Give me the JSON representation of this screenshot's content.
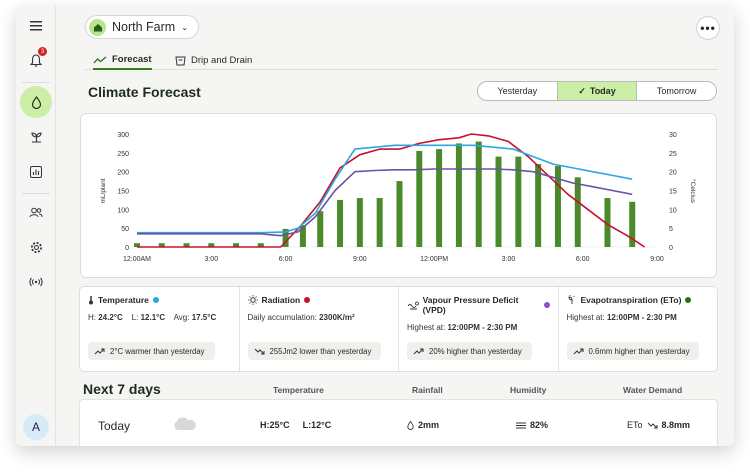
{
  "sidebar": {
    "notification_count": "3",
    "avatar_initial": "A"
  },
  "header": {
    "farm_name": "North Farm"
  },
  "tabs": [
    {
      "label": "Forecast"
    },
    {
      "label": "Drip and Drain"
    }
  ],
  "page_title": "Climate Forecast",
  "day_selector": {
    "options": [
      "Yesterday",
      "Today",
      "Tomorrow"
    ],
    "selected": "Today"
  },
  "chart_data": {
    "type": "bar+line",
    "x_ticks": [
      "12:00AM",
      "3:00",
      "6:00",
      "9:00",
      "12:00PM",
      "3:00",
      "6:00",
      "9:00"
    ],
    "y_left": {
      "label": "mL/plant",
      "ticks": [
        "0",
        "50",
        "100",
        "150",
        "200",
        "250",
        "300"
      ],
      "range": [
        0,
        300
      ]
    },
    "y_right": {
      "label": "°Celcius",
      "ticks": [
        "0",
        "5",
        "10",
        "15",
        "20",
        "25",
        "30"
      ],
      "range": [
        0,
        30
      ]
    },
    "bars": {
      "color": "#4a8a2a",
      "hours": [
        0,
        1,
        2,
        3,
        4,
        5,
        6,
        7,
        8,
        9,
        10,
        11,
        12,
        13,
        14,
        15,
        16,
        17,
        18,
        19,
        20,
        21
      ],
      "values": [
        10,
        10,
        10,
        10,
        10,
        10,
        48,
        58,
        95,
        125,
        130,
        130,
        175,
        255,
        260,
        275,
        280,
        240,
        240,
        220,
        215,
        185,
        130,
        120
      ]
    },
    "bar_hours": [
      0,
      1,
      2,
      3,
      4,
      5,
      6,
      6.7,
      7.4,
      8.2,
      9,
      9.8,
      10.6,
      11.4,
      12.2,
      13,
      13.8,
      14.6,
      15.4,
      16.2,
      17,
      17.8,
      19,
      20
    ],
    "series": [
      {
        "color": "#c8102e",
        "points": [
          [
            0,
            0
          ],
          [
            5.8,
            0
          ],
          [
            6.6,
            5.5
          ],
          [
            7.4,
            12
          ],
          [
            8.2,
            21
          ],
          [
            9,
            24.5
          ],
          [
            9.8,
            26
          ],
          [
            10.6,
            26
          ],
          [
            11.4,
            27.5
          ],
          [
            12.2,
            28.5
          ],
          [
            13,
            29
          ],
          [
            13.5,
            30
          ],
          [
            14.2,
            29.5
          ],
          [
            15,
            28
          ],
          [
            15.8,
            24
          ],
          [
            16.6,
            19
          ],
          [
            17.4,
            14
          ],
          [
            18.2,
            10
          ],
          [
            19,
            6
          ],
          [
            19.8,
            3
          ],
          [
            20.5,
            0
          ]
        ]
      },
      {
        "color": "#2aa7e0",
        "points": [
          [
            0,
            3.8
          ],
          [
            5,
            3.8
          ],
          [
            6,
            4
          ],
          [
            6.5,
            5
          ],
          [
            7.2,
            9
          ],
          [
            8,
            18
          ],
          [
            8.8,
            26
          ],
          [
            9.6,
            26.5
          ],
          [
            10.4,
            27
          ],
          [
            11.2,
            27
          ],
          [
            12,
            27
          ],
          [
            12.8,
            27
          ],
          [
            13.6,
            27
          ],
          [
            14.4,
            26.5
          ],
          [
            15.2,
            26
          ],
          [
            16,
            24
          ],
          [
            16.8,
            22
          ],
          [
            17.6,
            21
          ],
          [
            18.4,
            20
          ],
          [
            19.2,
            19
          ],
          [
            20,
            18
          ]
        ]
      },
      {
        "color": "#6a54a0",
        "points": [
          [
            0,
            3.5
          ],
          [
            5,
            3.5
          ],
          [
            5.8,
            3
          ],
          [
            6.5,
            4
          ],
          [
            7.2,
            8
          ],
          [
            8,
            15
          ],
          [
            8.8,
            20
          ],
          [
            9.6,
            20.3
          ],
          [
            10.4,
            20.5
          ],
          [
            11.2,
            20.5
          ],
          [
            12,
            20.7
          ],
          [
            12.8,
            20.7
          ],
          [
            13.6,
            20.7
          ],
          [
            14.4,
            20.7
          ],
          [
            15.2,
            20.5
          ],
          [
            16,
            20
          ],
          [
            16.8,
            18.5
          ],
          [
            17.6,
            17
          ],
          [
            18.4,
            16
          ],
          [
            19.2,
            15
          ],
          [
            20,
            14
          ]
        ]
      }
    ]
  },
  "metrics": [
    {
      "title": "Temperature",
      "dot_color": "#29a8e0",
      "lines": [
        {
          "label": "H:",
          "value": "24.2°C"
        },
        {
          "label": "L:",
          "value": "12.1°C"
        },
        {
          "label": "Avg:",
          "value": "17.5°C"
        }
      ],
      "chip": "2°C warmer than yesterday",
      "chip_icon": "trend-up-icon"
    },
    {
      "title": "Radiation",
      "dot_color": "#c8102e",
      "lines": [
        {
          "label": "Daily accumulation:",
          "value": "2300K/m²"
        }
      ],
      "chip": "255Jm2 lower than yesterday",
      "chip_icon": "trend-down-icon"
    },
    {
      "title": "Vapour Pressure Deficit (VPD)",
      "dot_color": "#8a4fcf",
      "lines": [
        {
          "label": "Highest at:",
          "value": "12:00PM - 2:30 PM"
        }
      ],
      "chip": "20% higher than yesterday",
      "chip_icon": "trend-up-icon"
    },
    {
      "title": "Evapotranspiration (ETo)",
      "dot_color": "#2e6b1c",
      "lines": [
        {
          "label": "Highest at:",
          "value": "12:00PM - 2:30 PM"
        }
      ],
      "chip": "0.6mm higher than yesterday",
      "chip_icon": "trend-up-icon"
    }
  ],
  "next_days": {
    "title": "Next 7 days",
    "columns": [
      "Temperature",
      "Rainfall",
      "Humidity",
      "Water Demand"
    ],
    "rows": [
      {
        "day": "Today",
        "weather_icon": "cloud-icon",
        "temp_high": "H:25°C",
        "temp_low": "L:12°C",
        "rain": "2mm",
        "humidity": "82%",
        "eto_label": "ETo",
        "eto": "8.8mm"
      }
    ]
  }
}
